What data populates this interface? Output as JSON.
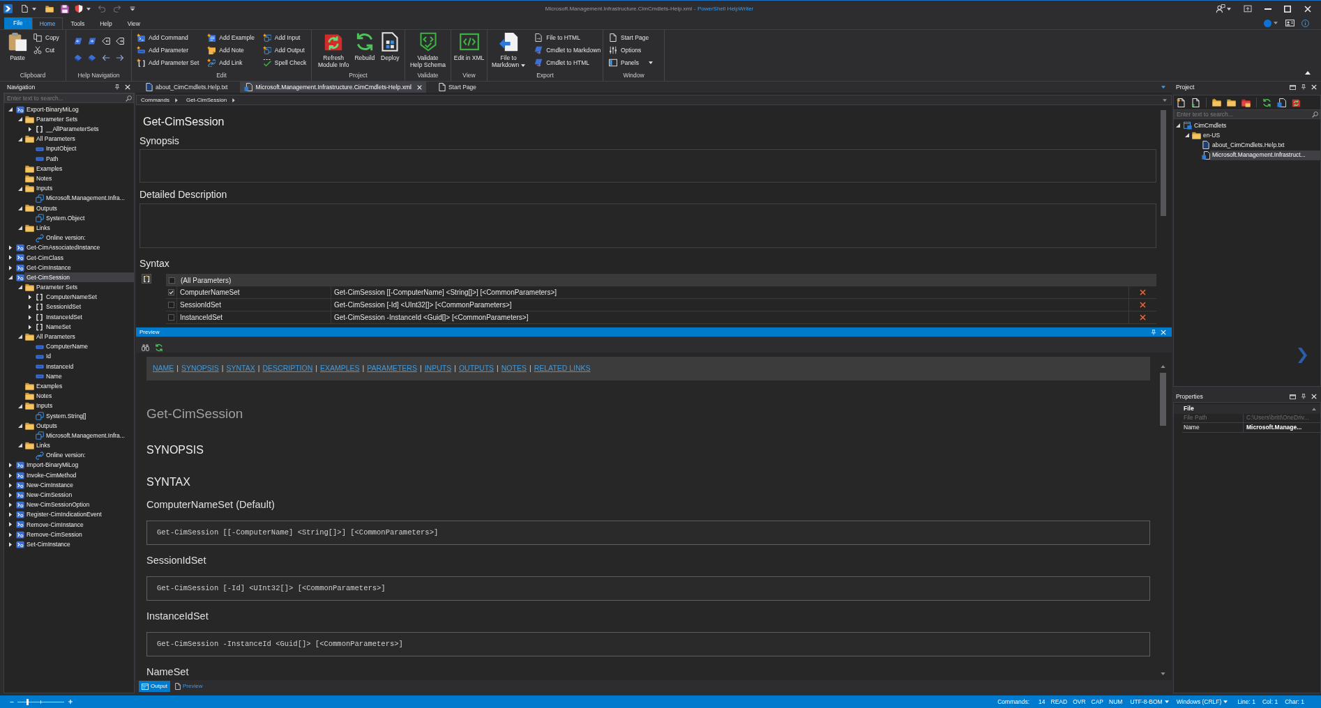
{
  "window": {
    "document_title": "Microsoft.Management.Infrastructure.CimCmdlets-Help.xml",
    "app_title": "- PowerShell HelpWriter"
  },
  "quick_access": [
    {
      "disabled": false
    },
    {
      "disabled": false
    },
    {
      "disabled": false
    },
    {
      "disabled": false
    },
    {
      "disabled": true
    },
    {
      "disabled": true
    }
  ],
  "ribbon_tabs": [
    {
      "label": "File",
      "kind": "application",
      "selected": false
    },
    {
      "label": "Home",
      "kind": "tab",
      "selected": true
    },
    {
      "label": "Tools",
      "kind": "tab",
      "selected": false
    },
    {
      "label": "Help",
      "kind": "tab",
      "selected": false
    },
    {
      "label": "View",
      "kind": "tab",
      "selected": false
    }
  ],
  "ribbon_groups": [
    {
      "label": "Clipboard",
      "columns": [
        {
          "kind": "large",
          "label": "Paste"
        },
        {
          "kind": "stack",
          "items": [
            {
              "label": "Copy"
            },
            {
              "label": "Cut"
            }
          ]
        }
      ]
    },
    {
      "label": "Help Navigation",
      "columns": [
        {
          "kind": "icon-grid"
        }
      ]
    },
    {
      "label": "Edit",
      "columns": [
        {
          "kind": "stack",
          "items": [
            {
              "label": "Add Command"
            },
            {
              "label": "Add Parameter"
            },
            {
              "label": "Add Parameter Set"
            }
          ]
        },
        {
          "kind": "stack",
          "items": [
            {
              "label": "Add Example"
            },
            {
              "label": "Add Note"
            },
            {
              "label": "Add Link"
            }
          ]
        },
        {
          "kind": "stack",
          "items": [
            {
              "label": "Add Input"
            },
            {
              "label": "Add Output"
            },
            {
              "label": "Spell Check"
            }
          ]
        }
      ]
    },
    {
      "label": "Project",
      "columns": [
        {
          "kind": "large",
          "label": "Refresh\nModule Info"
        },
        {
          "kind": "large",
          "label": "Rebuild"
        },
        {
          "kind": "large",
          "label": "Deploy"
        }
      ]
    },
    {
      "label": "Validate",
      "columns": [
        {
          "kind": "large",
          "label": "Validate\nHelp Schema"
        }
      ]
    },
    {
      "label": "View",
      "columns": [
        {
          "kind": "large",
          "label": "Edit in XML"
        }
      ]
    },
    {
      "label": "Export",
      "columns": [
        {
          "kind": "large",
          "label": "File to\nMarkdown",
          "dropdown": true
        },
        {
          "kind": "stack",
          "items": [
            {
              "label": "File to HTML"
            },
            {
              "label": "Cmdlet to Markdown"
            },
            {
              "label": "Cmdlet to HTML"
            }
          ]
        }
      ]
    },
    {
      "label": "Window",
      "columns": [
        {
          "kind": "stack",
          "items": [
            {
              "label": "Start Page"
            },
            {
              "label": "Options"
            },
            {
              "label": "Panels",
              "dropdown": true
            }
          ]
        }
      ]
    }
  ],
  "navigation": {
    "title": "Navigation",
    "search_placeholder": "Enter text to search...",
    "tree": [
      {
        "label": "Export-BinaryMiLog",
        "kind": "command",
        "expanded": true,
        "selected": false,
        "children": [
          {
            "label": "Parameter Sets",
            "kind": "folder",
            "expanded": true,
            "selected": false,
            "children": [
              {
                "label": "__AllParameterSets",
                "kind": "parameter-set",
                "expanded": false,
                "selected": false
              }
            ]
          },
          {
            "label": "All Parameters",
            "kind": "folder",
            "expanded": true,
            "selected": false,
            "children": [
              {
                "label": "InputObject",
                "kind": "parameter",
                "selected": false
              },
              {
                "label": "Path",
                "kind": "parameter",
                "selected": false
              }
            ]
          },
          {
            "label": "Examples",
            "kind": "folder",
            "selected": false
          },
          {
            "label": "Notes",
            "kind": "folder",
            "selected": false
          },
          {
            "label": "Inputs",
            "kind": "folder",
            "expanded": true,
            "selected": false,
            "children": [
              {
                "label": "Microsoft.Management.Infra...",
                "kind": "type",
                "selected": false
              }
            ]
          },
          {
            "label": "Outputs",
            "kind": "folder",
            "expanded": true,
            "selected": false,
            "children": [
              {
                "label": "System.Object",
                "kind": "type",
                "selected": false
              }
            ]
          },
          {
            "label": "Links",
            "kind": "folder",
            "expanded": true,
            "selected": false,
            "children": [
              {
                "label": "Online version:",
                "kind": "link",
                "selected": false
              }
            ]
          }
        ]
      },
      {
        "label": "Get-CimAssociatedInstance",
        "kind": "command",
        "expanded": false,
        "selected": false
      },
      {
        "label": "Get-CimClass",
        "kind": "command",
        "expanded": false,
        "selected": false
      },
      {
        "label": "Get-CimInstance",
        "kind": "command",
        "expanded": false,
        "selected": false
      },
      {
        "label": "Get-CimSession",
        "kind": "command",
        "expanded": true,
        "selected": true,
        "children": [
          {
            "label": "Parameter Sets",
            "kind": "folder",
            "expanded": true,
            "selected": false,
            "children": [
              {
                "label": "ComputerNameSet",
                "kind": "parameter-set",
                "expanded": false,
                "selected": false
              },
              {
                "label": "SessionIdSet",
                "kind": "parameter-set",
                "expanded": false,
                "selected": false
              },
              {
                "label": "InstanceIdSet",
                "kind": "parameter-set",
                "expanded": false,
                "selected": false
              },
              {
                "label": "NameSet",
                "kind": "parameter-set",
                "expanded": false,
                "selected": false
              }
            ]
          },
          {
            "label": "All Parameters",
            "kind": "folder",
            "expanded": true,
            "selected": false,
            "children": [
              {
                "label": "ComputerName",
                "kind": "parameter",
                "selected": false
              },
              {
                "label": "Id",
                "kind": "parameter",
                "selected": false
              },
              {
                "label": "InstanceId",
                "kind": "parameter",
                "selected": false
              },
              {
                "label": "Name",
                "kind": "parameter",
                "selected": false
              }
            ]
          },
          {
            "label": "Examples",
            "kind": "folder",
            "selected": false
          },
          {
            "label": "Notes",
            "kind": "folder",
            "selected": false
          },
          {
            "label": "Inputs",
            "kind": "folder",
            "expanded": true,
            "selected": false,
            "children": [
              {
                "label": "System.String[]",
                "kind": "type",
                "selected": false
              }
            ]
          },
          {
            "label": "Outputs",
            "kind": "folder",
            "expanded": true,
            "selected": false,
            "children": [
              {
                "label": "Microsoft.Management.Infra...",
                "kind": "type",
                "selected": false
              }
            ]
          },
          {
            "label": "Links",
            "kind": "folder",
            "expanded": true,
            "selected": false,
            "children": [
              {
                "label": "Online version:",
                "kind": "link",
                "selected": false
              }
            ]
          }
        ]
      },
      {
        "label": "Import-BinaryMiLog",
        "kind": "command",
        "expanded": false,
        "selected": false
      },
      {
        "label": "Invoke-CimMethod",
        "kind": "command",
        "expanded": false,
        "selected": false
      },
      {
        "label": "New-CimInstance",
        "kind": "command",
        "expanded": false,
        "selected": false
      },
      {
        "label": "New-CimSession",
        "kind": "command",
        "expanded": false,
        "selected": false
      },
      {
        "label": "New-CimSessionOption",
        "kind": "command",
        "expanded": false,
        "selected": false
      },
      {
        "label": "Register-CimIndicationEvent",
        "kind": "command",
        "expanded": false,
        "selected": false
      },
      {
        "label": "Remove-CimInstance",
        "kind": "command",
        "expanded": false,
        "selected": false
      },
      {
        "label": "Remove-CimSession",
        "kind": "command",
        "expanded": false,
        "selected": false
      },
      {
        "label": "Set-CimInstance",
        "kind": "command",
        "expanded": false,
        "selected": false
      }
    ]
  },
  "document_tabs": [
    {
      "label": "about_CimCmdlets.Help.txt",
      "kind": "text-file",
      "selected": false
    },
    {
      "label": "Microsoft.Management.Infrastructure.CimCmdlets-Help.xml",
      "kind": "xml-file",
      "selected": true
    },
    {
      "label": "Start Page",
      "kind": "page",
      "selected": false
    }
  ],
  "breadcrumb": [
    "Commands",
    "Get-CimSession"
  ],
  "editor": {
    "heading": "Get-CimSession",
    "synopsis": {
      "label": "Synopsis"
    },
    "description": {
      "label": "Detailed Description"
    },
    "syntax": {
      "label": "Syntax",
      "all_parameters": {
        "label": "(All Parameters)",
        "checked": false
      },
      "rows": [
        {
          "name": "ComputerNameSet",
          "syntax": "Get-CimSession [[-ComputerName] <String[]>] [<CommonParameters>]",
          "checked": true
        },
        {
          "name": "SessionIdSet",
          "syntax": "Get-CimSession [-Id] <UInt32[]> [<CommonParameters>]",
          "checked": false
        },
        {
          "name": "InstanceIdSet",
          "syntax": "Get-CimSession -InstanceId <Guid[]> [<CommonParameters>]",
          "checked": false
        }
      ]
    }
  },
  "preview": {
    "title": "Preview",
    "nav": [
      {
        "kind": "link",
        "text": "NAME"
      },
      {
        "kind": "separator",
        "text": "|"
      },
      {
        "kind": "link",
        "text": "SYNOPSIS"
      },
      {
        "kind": "separator",
        "text": "|"
      },
      {
        "kind": "link",
        "text": "SYNTAX"
      },
      {
        "kind": "separator",
        "text": "|"
      },
      {
        "kind": "link",
        "text": "DESCRIPTION"
      },
      {
        "kind": "separator",
        "text": "|"
      },
      {
        "kind": "link",
        "text": "EXAMPLES"
      },
      {
        "kind": "separator",
        "text": "|"
      },
      {
        "kind": "link",
        "text": "PARAMETERS"
      },
      {
        "kind": "separator",
        "text": "|"
      },
      {
        "kind": "link",
        "text": "INPUTS"
      },
      {
        "kind": "separator",
        "text": "|"
      },
      {
        "kind": "link",
        "text": "OUTPUTS"
      },
      {
        "kind": "separator",
        "text": "|"
      },
      {
        "kind": "link",
        "text": "NOTES"
      },
      {
        "kind": "separator",
        "text": "|"
      },
      {
        "kind": "link",
        "text": "RELATED LINKS"
      }
    ],
    "heading": "Get-CimSession",
    "blocks": [
      {
        "kind": "h2",
        "text": "SYNOPSIS"
      },
      {
        "kind": "h2",
        "text": "SYNTAX"
      },
      {
        "kind": "h3",
        "text": "ComputerNameSet (Default)"
      },
      {
        "kind": "code",
        "text": "Get-CimSession [[-ComputerName] <String[]>] [<CommonParameters>]"
      },
      {
        "kind": "h3",
        "text": "SessionIdSet"
      },
      {
        "kind": "code",
        "text": "Get-CimSession [-Id] <UInt32[]> [<CommonParameters>]"
      },
      {
        "kind": "h3",
        "text": "InstanceIdSet"
      },
      {
        "kind": "code",
        "text": "Get-CimSession -InstanceId <Guid[]> [<CommonParameters>]"
      },
      {
        "kind": "h3",
        "text": "NameSet"
      }
    ]
  },
  "bottom_tabs": [
    {
      "label": "Output",
      "selected": true
    },
    {
      "label": "Preview",
      "selected": false
    }
  ],
  "project": {
    "title": "Project",
    "search_placeholder": "Enter text to search...",
    "tree": [
      {
        "label": "CimCmdlets",
        "kind": "module",
        "expanded": true,
        "selected": false,
        "children": [
          {
            "label": "en-US",
            "kind": "folder",
            "expanded": true,
            "selected": false,
            "children": [
              {
                "label": "about_CimCmdlets.Help.txt",
                "kind": "text-file",
                "selected": false
              },
              {
                "label": "Microsoft.Management.Infrastruct...",
                "kind": "xml-file",
                "selected": true
              }
            ]
          }
        ]
      }
    ]
  },
  "properties": {
    "title": "Properties",
    "category": {
      "label": "File",
      "expanded": true
    },
    "rows": [
      {
        "name": "File Path",
        "value": "C:\\Users\\britt\\OneDriv...",
        "disabled": true
      },
      {
        "name": "Name",
        "value": "Microsoft.Manage...",
        "disabled": false
      }
    ]
  },
  "status_bar": {
    "zoom": {
      "level": 0.22
    },
    "commands_label": "Commands:",
    "commands_count": "14",
    "indicators": [
      "READ",
      "OVR",
      "CAP",
      "NUM"
    ],
    "encoding": {
      "label": "UTF-8-BOM",
      "dropdown": true
    },
    "line_endings": {
      "label": "Windows (CRLF)",
      "dropdown": true
    },
    "position": [
      "Line: 1",
      "Col: 1",
      "Char: 1"
    ]
  }
}
